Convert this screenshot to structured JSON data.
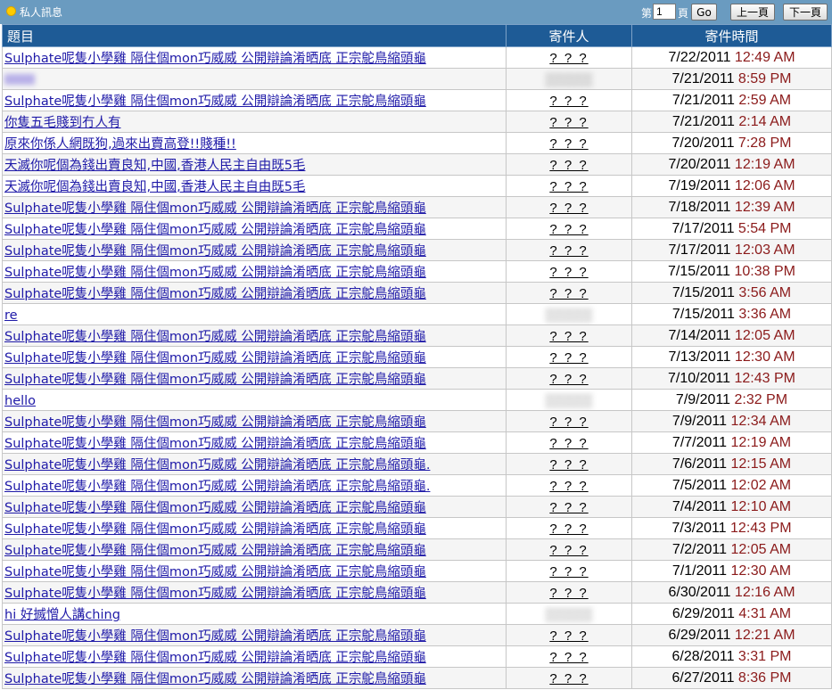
{
  "header": {
    "title": "私人訊息",
    "page_prefix": "第",
    "page_value": "1",
    "page_suffix": "頁",
    "go_label": "Go",
    "prev_label": "上一頁",
    "next_label": "下一頁"
  },
  "columns": {
    "subject": "題目",
    "sender": "寄件人",
    "time": "寄件時間"
  },
  "rows": [
    {
      "subject": "Sulphate呢隻小學雞 隔住個mon巧威威 公開辯論淆晒底 正宗鴕鳥縮頭龜",
      "sender": "? ? ?",
      "date": "7/22/2011",
      "time": "12:49 AM"
    },
    {
      "subject": "",
      "sender": "",
      "blurred": true,
      "date": "7/21/2011",
      "time": "8:59 PM"
    },
    {
      "subject": "Sulphate呢隻小學雞 隔住個mon巧威威 公開辯論淆晒底 正宗鴕鳥縮頭龜",
      "sender": "? ? ?",
      "date": "7/21/2011",
      "time": "2:59 AM"
    },
    {
      "subject": "你隻五毛賤到冇人有",
      "sender": "? ? ?",
      "date": "7/21/2011",
      "time": "2:14 AM"
    },
    {
      "subject": "原來你係人網既狗,過來出賣高登!!賤種!!",
      "sender": "? ? ?",
      "date": "7/20/2011",
      "time": "7:28 PM"
    },
    {
      "subject": "天滅你呢個為錢出賣良知,中國,香港人民主自由既5毛",
      "sender": "? ? ?",
      "date": "7/20/2011",
      "time": "12:19 AM"
    },
    {
      "subject": "天滅你呢個為錢出賣良知,中國,香港人民主自由既5毛",
      "sender": "? ? ?",
      "date": "7/19/2011",
      "time": "12:06 AM"
    },
    {
      "subject": "Sulphate呢隻小學雞 隔住個mon巧威威 公開辯論淆晒底 正宗鴕鳥縮頭龜",
      "sender": "? ? ?",
      "date": "7/18/2011",
      "time": "12:39 AM"
    },
    {
      "subject": "Sulphate呢隻小學雞 隔住個mon巧威威 公開辯論淆晒底 正宗鴕鳥縮頭龜",
      "sender": "? ? ?",
      "date": "7/17/2011",
      "time": "5:54 PM"
    },
    {
      "subject": "Sulphate呢隻小學雞 隔住個mon巧威威 公開辯論淆晒底 正宗鴕鳥縮頭龜",
      "sender": "? ? ?",
      "date": "7/17/2011",
      "time": "12:03 AM"
    },
    {
      "subject": "Sulphate呢隻小學雞 隔住個mon巧威威 公開辯論淆晒底 正宗鴕鳥縮頭龜",
      "sender": "? ? ?",
      "date": "7/15/2011",
      "time": "10:38 PM"
    },
    {
      "subject": "Sulphate呢隻小學雞 隔住個mon巧威威 公開辯論淆晒底 正宗鴕鳥縮頭龜",
      "sender": "? ? ?",
      "date": "7/15/2011",
      "time": "3:56 AM"
    },
    {
      "subject": "re",
      "sender": "",
      "blurred_sender": true,
      "date": "7/15/2011",
      "time": "3:36 AM"
    },
    {
      "subject": "Sulphate呢隻小學雞 隔住個mon巧威威 公開辯論淆晒底 正宗鴕鳥縮頭龜",
      "sender": "? ? ?",
      "date": "7/14/2011",
      "time": "12:05 AM"
    },
    {
      "subject": "Sulphate呢隻小學雞 隔住個mon巧威威 公開辯論淆晒底 正宗鴕鳥縮頭龜",
      "sender": "? ? ?",
      "date": "7/13/2011",
      "time": "12:30 AM"
    },
    {
      "subject": "Sulphate呢隻小學雞 隔住個mon巧威威 公開辯論淆晒底 正宗鴕鳥縮頭龜",
      "sender": "? ? ?",
      "date": "7/10/2011",
      "time": "12:43 PM"
    },
    {
      "subject": "hello",
      "sender": "",
      "blurred_sender": true,
      "date": "7/9/2011",
      "time": "2:32 PM"
    },
    {
      "subject": "Sulphate呢隻小學雞 隔住個mon巧威威 公開辯論淆晒底 正宗鴕鳥縮頭龜",
      "sender": "? ? ?",
      "date": "7/9/2011",
      "time": "12:34 AM"
    },
    {
      "subject": "Sulphate呢隻小學雞 隔住個mon巧威威 公開辯論淆晒底 正宗鴕鳥縮頭龜",
      "sender": "? ? ?",
      "date": "7/7/2011",
      "time": "12:19 AM"
    },
    {
      "subject": "Sulphate呢隻小學雞 隔住個mon巧威威 公開辯論淆晒底 正宗鴕鳥縮頭龜.",
      "sender": "? ? ?",
      "date": "7/6/2011",
      "time": "12:15 AM"
    },
    {
      "subject": "Sulphate呢隻小學雞 隔住個mon巧威威 公開辯論淆晒底 正宗鴕鳥縮頭龜.",
      "sender": "? ? ?",
      "date": "7/5/2011",
      "time": "12:02 AM"
    },
    {
      "subject": "Sulphate呢隻小學雞 隔住個mon巧威威 公開辯論淆晒底 正宗鴕鳥縮頭龜",
      "sender": "? ? ?",
      "date": "7/4/2011",
      "time": "12:10 AM"
    },
    {
      "subject": "Sulphate呢隻小學雞 隔住個mon巧威威 公開辯論淆晒底 正宗鴕鳥縮頭龜",
      "sender": "? ? ?",
      "date": "7/3/2011",
      "time": "12:43 PM"
    },
    {
      "subject": "Sulphate呢隻小學雞 隔住個mon巧威威 公開辯論淆晒底 正宗鴕鳥縮頭龜",
      "sender": "? ? ?",
      "date": "7/2/2011",
      "time": "12:05 AM"
    },
    {
      "subject": "Sulphate呢隻小學雞 隔住個mon巧威威 公開辯論淆晒底 正宗鴕鳥縮頭龜",
      "sender": "? ? ?",
      "date": "7/1/2011",
      "time": "12:30 AM"
    },
    {
      "subject": "Sulphate呢隻小學雞 隔住個mon巧威威 公開辯論淆晒底 正宗鴕鳥縮頭龜",
      "sender": "? ? ?",
      "date": "6/30/2011",
      "time": "12:16 AM"
    },
    {
      "subject": "hi 好搣憎人講ching",
      "sender": "",
      "blurred_sender": true,
      "date": "6/29/2011",
      "time": "4:31 AM"
    },
    {
      "subject": "Sulphate呢隻小學雞 隔住個mon巧威威 公開辯論淆晒底 正宗鴕鳥縮頭龜",
      "sender": "? ? ?",
      "date": "6/29/2011",
      "time": "12:21 AM"
    },
    {
      "subject": "Sulphate呢隻小學雞 隔住個mon巧威威 公開辯論淆晒底 正宗鴕鳥縮頭龜",
      "sender": "? ? ?",
      "date": "6/28/2011",
      "time": "3:31 PM"
    },
    {
      "subject": "Sulphate呢隻小學雞 隔住個mon巧威威 公開辯論淆晒底 正宗鴕鳥縮頭龜",
      "sender": "? ? ?",
      "date": "6/27/2011",
      "time": "8:36 PM"
    }
  ]
}
